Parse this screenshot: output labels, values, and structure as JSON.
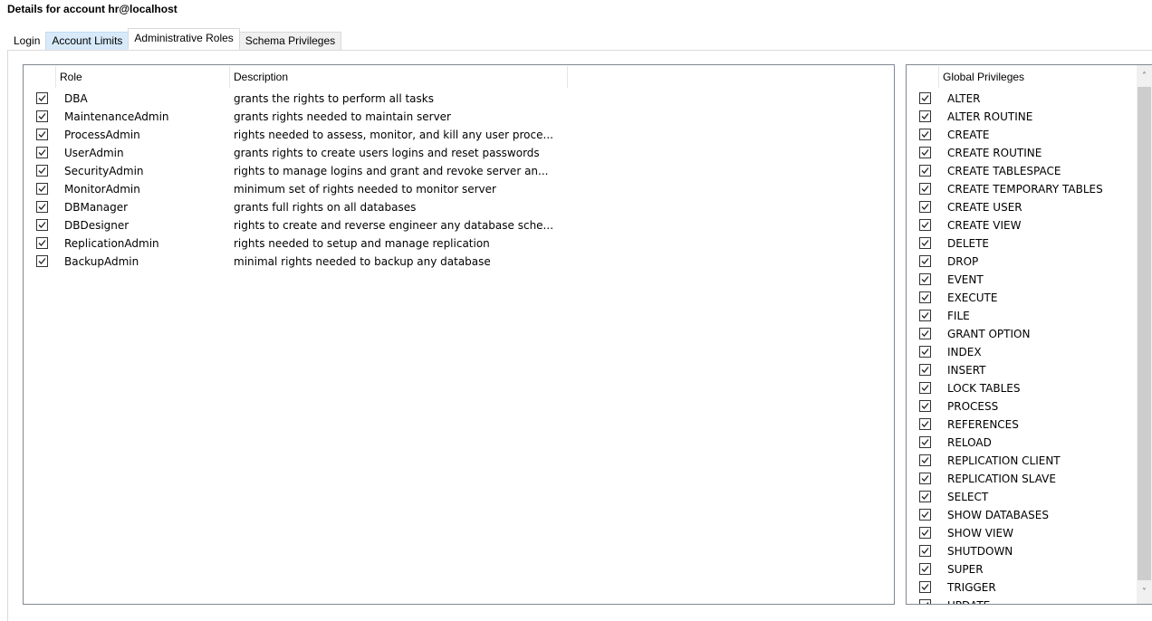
{
  "window": {
    "title": "Details for account hr@localhost"
  },
  "tabs": [
    {
      "label": "Login"
    },
    {
      "label": "Account Limits"
    },
    {
      "label": "Administrative Roles"
    },
    {
      "label": "Schema Privileges"
    }
  ],
  "roles_table": {
    "headers": {
      "role": "Role",
      "description": "Description"
    },
    "rows": [
      {
        "role": "DBA",
        "description": "grants the rights to perform all tasks",
        "checked": true
      },
      {
        "role": "MaintenanceAdmin",
        "description": "grants rights needed to maintain server",
        "checked": true
      },
      {
        "role": "ProcessAdmin",
        "description": "rights needed to assess, monitor, and kill any user proce...",
        "checked": true
      },
      {
        "role": "UserAdmin",
        "description": "grants rights to create users logins and reset passwords",
        "checked": true
      },
      {
        "role": "SecurityAdmin",
        "description": "rights to manage logins and grant and revoke server an...",
        "checked": true
      },
      {
        "role": "MonitorAdmin",
        "description": "minimum set of rights needed to monitor server",
        "checked": true
      },
      {
        "role": "DBManager",
        "description": "grants full rights on all databases",
        "checked": true
      },
      {
        "role": "DBDesigner",
        "description": "rights to create and reverse engineer any database sche...",
        "checked": true
      },
      {
        "role": "ReplicationAdmin",
        "description": "rights needed to setup and manage replication",
        "checked": true
      },
      {
        "role": "BackupAdmin",
        "description": "minimal rights needed to backup any database",
        "checked": true
      }
    ]
  },
  "privileges_table": {
    "header": "Global Privileges",
    "rows": [
      "ALTER",
      "ALTER ROUTINE",
      "CREATE",
      "CREATE ROUTINE",
      "CREATE TABLESPACE",
      "CREATE TEMPORARY TABLES",
      "CREATE USER",
      "CREATE VIEW",
      "DELETE",
      "DROP",
      "EVENT",
      "EXECUTE",
      "FILE",
      "GRANT OPTION",
      "INDEX",
      "INSERT",
      "LOCK TABLES",
      "PROCESS",
      "REFERENCES",
      "RELOAD",
      "REPLICATION CLIENT",
      "REPLICATION SLAVE",
      "SELECT",
      "SHOW DATABASES",
      "SHOW VIEW",
      "SHUTDOWN",
      "SUPER",
      "TRIGGER",
      "UPDATE"
    ],
    "all_checked": true
  },
  "icons": {
    "checkbox": "checkbox-checked-icon",
    "scroll_up": "chevron-up-icon",
    "scroll_down": "chevron-down-icon"
  },
  "colors": {
    "border": "#828790",
    "tab_hover": "#d8eaf9",
    "scroll_thumb": "#cdcdcd"
  }
}
